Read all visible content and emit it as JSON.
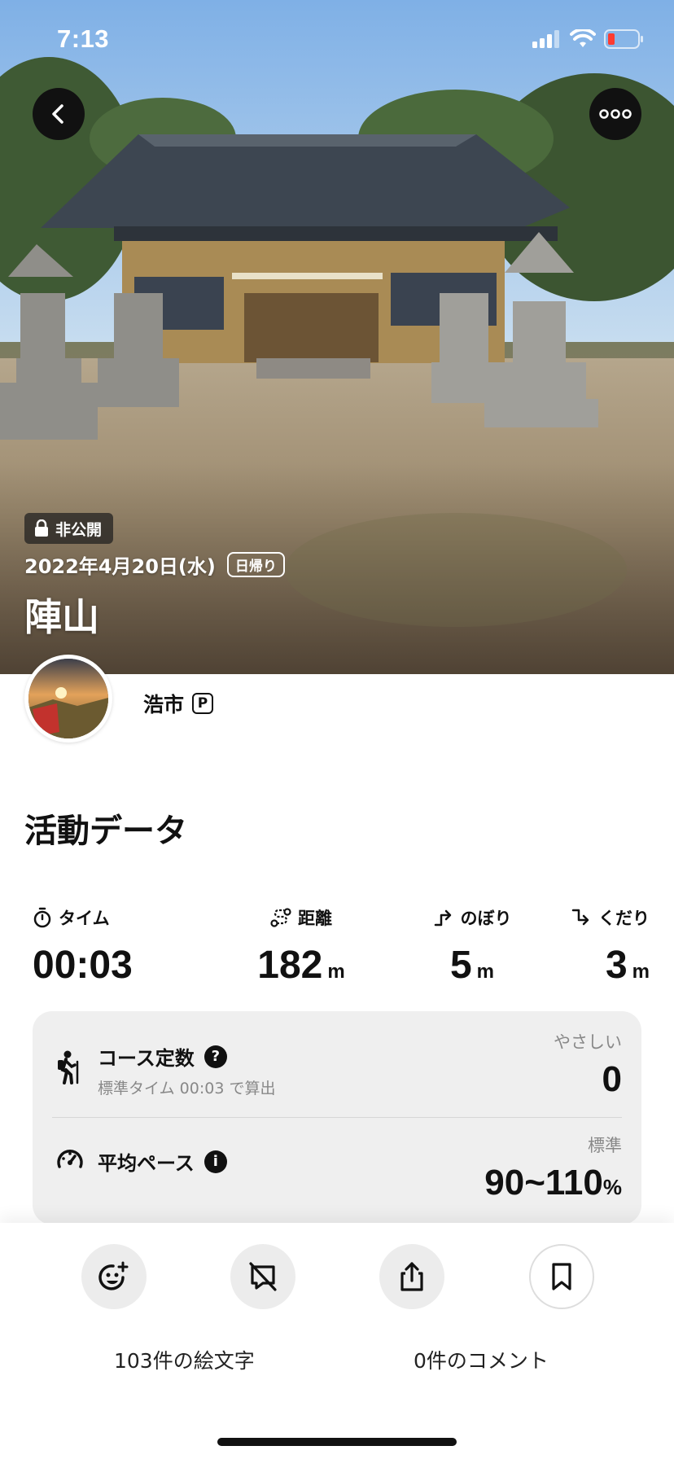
{
  "status_bar": {
    "time": "7:13"
  },
  "header": {
    "back_icon": "chevron-left-icon",
    "more_icon": "ellipsis-icon"
  },
  "record": {
    "visibility": "非公開",
    "date": "2022年4月20日(水)",
    "trip_type": "日帰り",
    "title": "陣山"
  },
  "user": {
    "name": "浩市",
    "badge": "P"
  },
  "activity": {
    "title": "活動データ",
    "stats": [
      {
        "label": "タイム",
        "value": "00:03",
        "unit": "",
        "icon": "stopwatch-icon"
      },
      {
        "label": "距離",
        "value": "182",
        "unit": "m",
        "icon": "route-icon"
      },
      {
        "label": "のぼり",
        "value": "5",
        "unit": "m",
        "icon": "ascent-icon"
      },
      {
        "label": "くだり",
        "value": "3",
        "unit": "m",
        "icon": "descent-icon"
      }
    ],
    "course": {
      "title": "コース定数",
      "subtitle": "標準タイム 00:03 で算出",
      "level": "やさしい",
      "value": "0"
    },
    "pace": {
      "title": "平均ペース",
      "level": "標準",
      "value": "90~110",
      "unit": "%"
    }
  },
  "actions": {
    "emoji_count": "103件の絵文字",
    "comment_count": "0件のコメント"
  },
  "colors": {
    "accent_dark": "#111111",
    "card_bg": "#efefef",
    "muted_text": "#888888"
  }
}
